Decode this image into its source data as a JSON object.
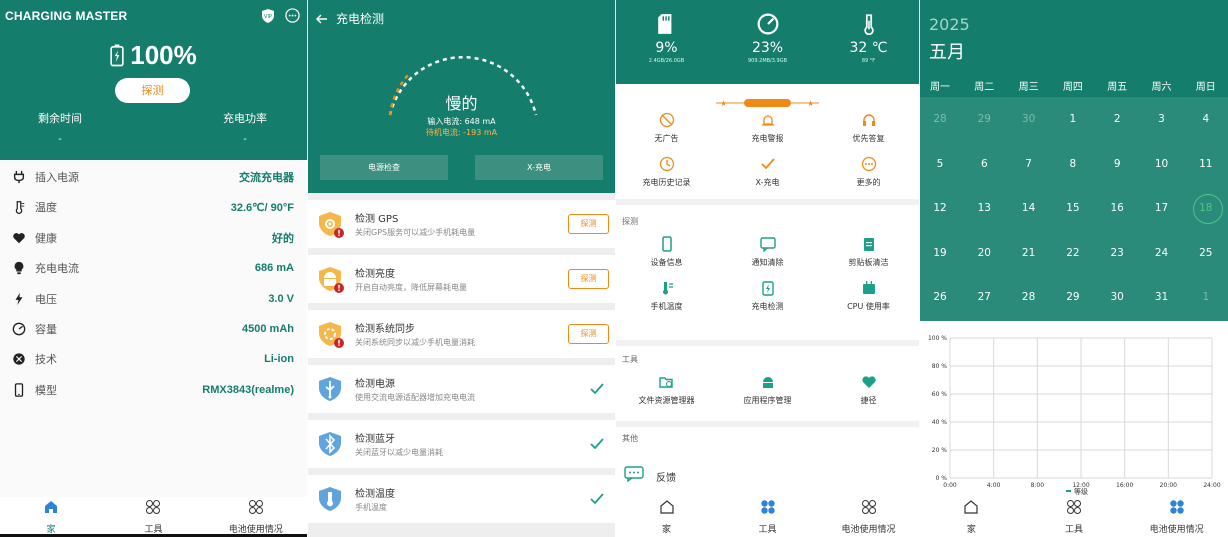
{
  "panel1": {
    "title": "CHARGING MASTER",
    "vip_badge": "VIP",
    "percent": "100%",
    "scan_button": "探测",
    "remaining_label": "剩余时间",
    "remaining_value": "-",
    "power_label": "充电功率",
    "power_value": "-",
    "rows": [
      {
        "label": "插入电源",
        "value": "交流充电器",
        "icon": "plug-icon"
      },
      {
        "label": "温度",
        "value": "32.6℃/ 90°F",
        "icon": "thermometer-icon"
      },
      {
        "label": "健康",
        "value": "好的",
        "icon": "heart-icon"
      },
      {
        "label": "充电电流",
        "value": "686 mA",
        "icon": "bulb-icon"
      },
      {
        "label": "电压",
        "value": "3.0 V",
        "icon": "bolt-icon"
      },
      {
        "label": "容量",
        "value": "4500 mAh",
        "icon": "gauge-icon"
      },
      {
        "label": "技术",
        "value": "Li-ion",
        "icon": "chip-icon"
      },
      {
        "label": "模型",
        "value": "RMX3843(realme)",
        "icon": "phone-icon"
      }
    ]
  },
  "panel2": {
    "title": "充电检测",
    "status": "慢的",
    "input_current": "输入电流: 648 mA",
    "standby_current": "待机电流: -193 mA",
    "tab_power_check": "电源检查",
    "tab_xcharge": "X-充电",
    "items": [
      {
        "title": "检测 GPS",
        "desc": "关闭GPS服务可以减少手机耗电量",
        "action": "探测",
        "done": false,
        "icon": "gps-icon"
      },
      {
        "title": "检测亮度",
        "desc": "开启自动亮度，降低屏幕耗电量",
        "action": "探测",
        "done": false,
        "icon": "android-icon"
      },
      {
        "title": "检测系统同步",
        "desc": "关闭系统同步以减少手机电量消耗",
        "action": "探测",
        "done": false,
        "icon": "sync-icon"
      },
      {
        "title": "检测电源",
        "desc": "使用交流电源适配器增加充电电流",
        "action": "",
        "done": true,
        "icon": "usb-icon"
      },
      {
        "title": "检测蓝牙",
        "desc": "关闭蓝牙以减少电量消耗",
        "action": "",
        "done": true,
        "icon": "bluetooth-icon"
      },
      {
        "title": "检测温度",
        "desc": "手机温度",
        "action": "",
        "done": true,
        "icon": "thermometer-icon"
      }
    ]
  },
  "panel3": {
    "stats": [
      {
        "value": "9%",
        "sub": "2.4GB/26.0GB",
        "icon": "sd-card-icon"
      },
      {
        "value": "23%",
        "sub": "909.2MB/3.9GB",
        "icon": "gauge-icon"
      },
      {
        "value": "32 ℃",
        "sub": "89 °F",
        "icon": "thermometer-icon"
      }
    ],
    "vip_label": "V · I · P",
    "vip_items": [
      {
        "label": "无广告",
        "icon": "no-ads-icon"
      },
      {
        "label": "充电警报",
        "icon": "alarm-icon"
      },
      {
        "label": "优先答复",
        "icon": "headset-icon"
      },
      {
        "label": "充电历史记录",
        "icon": "clock-icon"
      },
      {
        "label": "X-充电",
        "icon": "check-icon"
      },
      {
        "label": "更多的",
        "icon": "more-icon"
      }
    ],
    "probe_header": "探测",
    "probe_items": [
      {
        "label": "设备信息",
        "icon": "phone-icon"
      },
      {
        "label": "通知清除",
        "icon": "chat-icon"
      },
      {
        "label": "剪贴板清洁",
        "icon": "clipboard-icon"
      },
      {
        "label": "手机温度",
        "icon": "temp-icon"
      },
      {
        "label": "充电检测",
        "icon": "battery-charge-icon"
      },
      {
        "label": "CPU 使用率",
        "icon": "cpu-icon"
      }
    ],
    "tools_header": "工具",
    "tools_items": [
      {
        "label": "文件资源管理器",
        "icon": "folder-search-icon"
      },
      {
        "label": "应用程序管理",
        "icon": "android-icon"
      },
      {
        "label": "捷径",
        "icon": "heart-icon"
      }
    ],
    "other_header": "其他",
    "feedback": "反馈"
  },
  "panel4": {
    "year": "2025",
    "month": "五月",
    "weekdays": [
      "周一",
      "周二",
      "周三",
      "周四",
      "周五",
      "周六",
      "周日"
    ],
    "weeks": [
      [
        "28",
        "29",
        "30",
        "1",
        "2",
        "3",
        "4"
      ],
      [
        "5",
        "6",
        "7",
        "8",
        "9",
        "10",
        "11"
      ],
      [
        "12",
        "13",
        "14",
        "15",
        "16",
        "17",
        "18"
      ],
      [
        "19",
        "20",
        "21",
        "22",
        "23",
        "24",
        "25"
      ],
      [
        "26",
        "27",
        "28",
        "29",
        "30",
        "31",
        "1"
      ]
    ],
    "dim_days": [
      [
        0,
        0
      ],
      [
        0,
        1
      ],
      [
        0,
        2
      ],
      [
        4,
        6
      ]
    ],
    "today": [
      2,
      6
    ],
    "chart_data": {
      "type": "line",
      "x_ticks": [
        "0:00",
        "4:00",
        "8:00",
        "12:00",
        "16:00",
        "20:00",
        "24:00"
      ],
      "y_ticks": [
        "0 %",
        "20 %",
        "40 %",
        "60 %",
        "80 %",
        "100 %"
      ],
      "ylim": [
        0,
        100
      ],
      "series": [
        {
          "name": "等级",
          "values": []
        }
      ],
      "legend": "bottom-center",
      "grid": true
    }
  },
  "nav": {
    "home": "家",
    "tools": "工具",
    "battery_usage": "电池使用情况"
  },
  "colors": {
    "primary": "#157d6b",
    "accent": "#ef8a17",
    "check": "#1ca087"
  }
}
